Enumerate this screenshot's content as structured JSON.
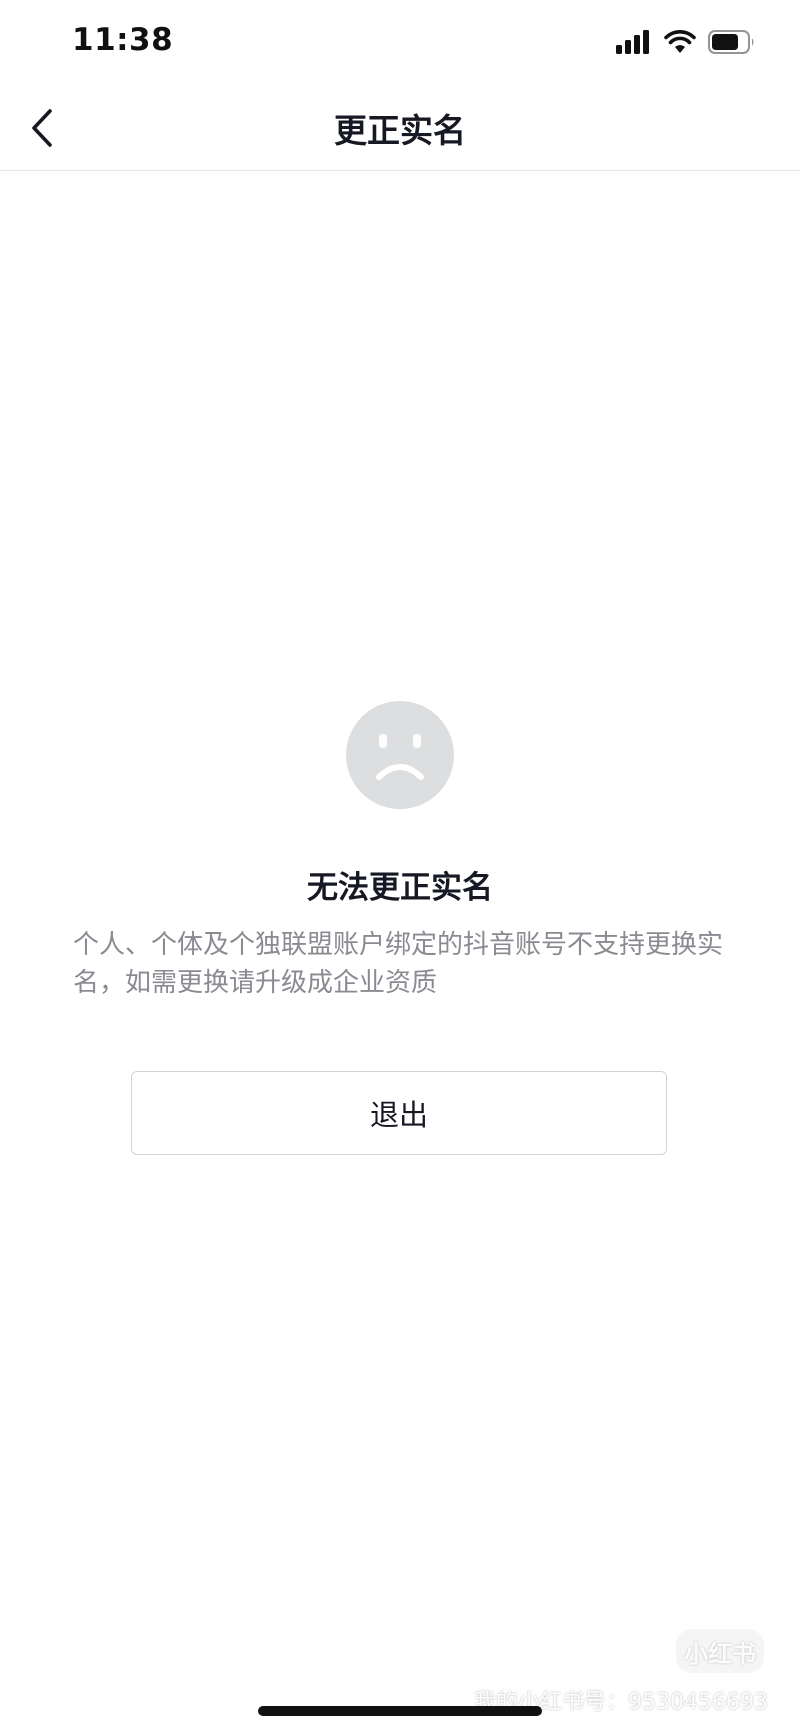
{
  "status_bar": {
    "time": "11:38",
    "icons": [
      "signal-icon",
      "wifi-icon",
      "battery-icon"
    ]
  },
  "nav": {
    "title": "更正实名",
    "back_icon": "chevron-left-icon"
  },
  "empty_state": {
    "icon": "sad-face-icon",
    "title": "无法更正实名",
    "description": "个人、个体及个独联盟账户绑定的抖音账号不支持更换实名，如需更换请升级成企业资质",
    "exit_label": "退出"
  },
  "watermark": {
    "logo": "小红书",
    "text": "我的小红书号：9530456693"
  },
  "colors": {
    "text_primary": "#161823",
    "text_secondary": "#8a8b91",
    "face_circle": "#dcdee0",
    "button_border": "#d3d4d7"
  }
}
